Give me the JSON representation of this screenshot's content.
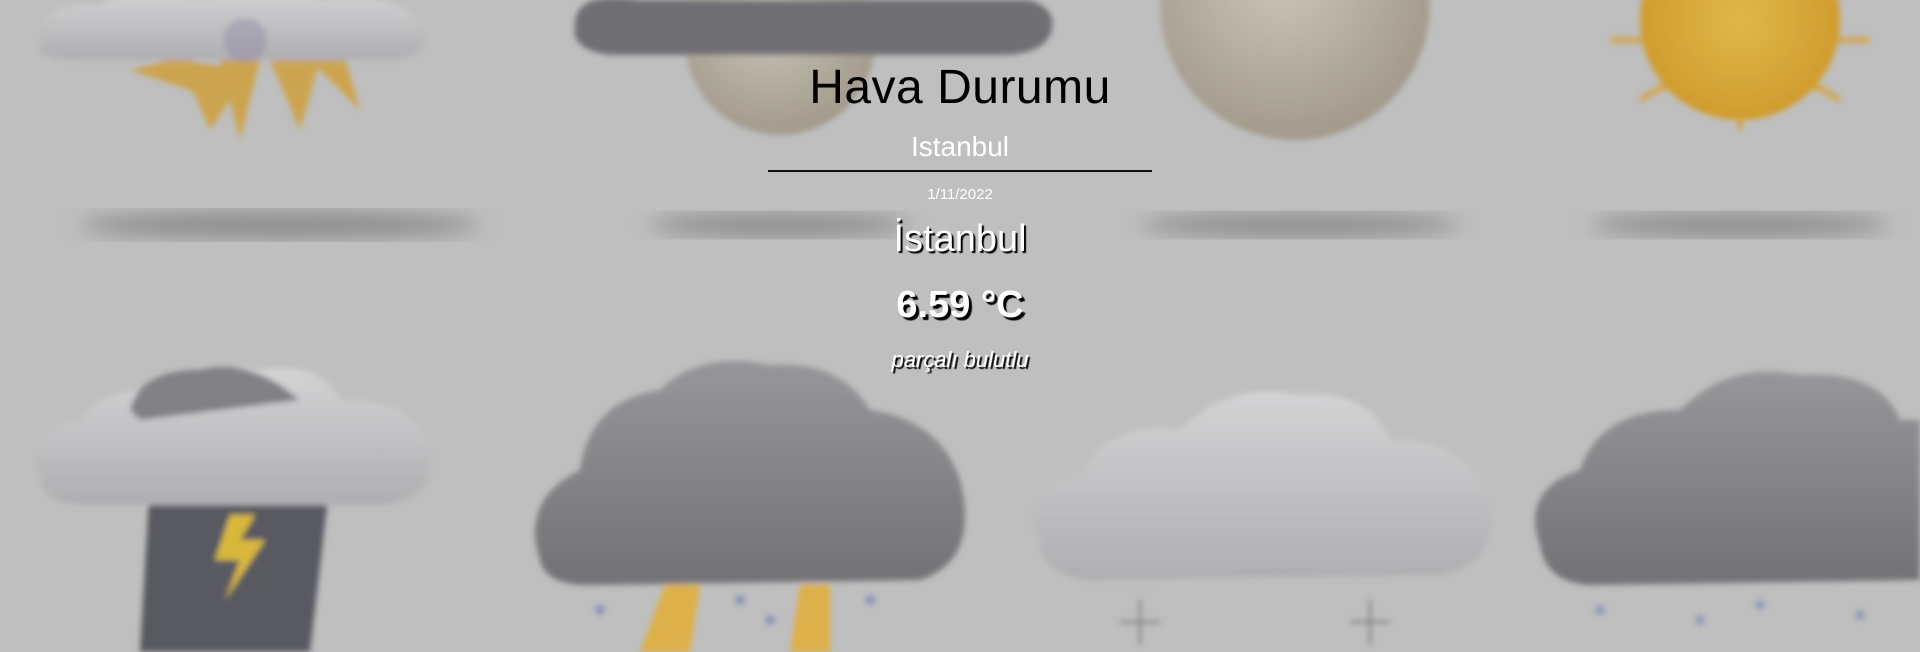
{
  "app": {
    "title": "Hava Durumu"
  },
  "search": {
    "value": "Istanbul",
    "placeholder": ""
  },
  "weather": {
    "date": "1/11/2022",
    "city": "İstanbul",
    "temperature": "6.59 °C",
    "description": "parçalı bulutlu"
  },
  "background": {
    "icons": [
      "sun-behind-cloud-icon",
      "cloud-icon",
      "moon-icon",
      "sun-icon",
      "thunderstorm-cloud-icon",
      "rain-cloud-icon",
      "snow-cloud-icon",
      "rain-cloud-icon"
    ]
  },
  "colors": {
    "text_primary": "#000000",
    "text_light": "#ffffff",
    "background": "#c9c9c9"
  }
}
